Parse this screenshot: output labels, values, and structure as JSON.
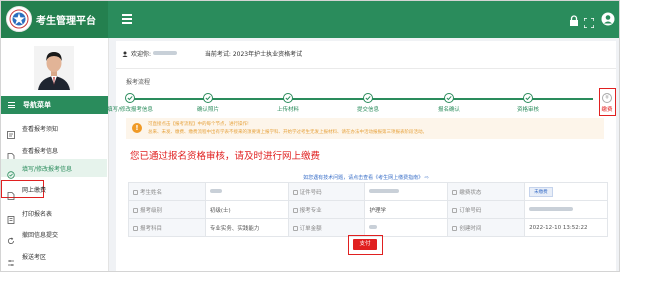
{
  "app": {
    "title": "考生管理平台"
  },
  "topbar": {
    "icons": [
      "lock-icon",
      "fullscreen-icon",
      "account-icon"
    ]
  },
  "sidebar": {
    "nav_header": "导航菜单",
    "items": [
      {
        "label": "查看报考须知",
        "icon": "notice-icon"
      },
      {
        "label": "查看报考信息",
        "icon": "document-icon"
      },
      {
        "label": "填写/修改报考信息",
        "icon": "edit-icon",
        "active": true
      },
      {
        "label": "网上缴费",
        "icon": "payment-icon",
        "highlighted": true
      },
      {
        "label": "打印报名表",
        "icon": "print-icon"
      },
      {
        "label": "撤回信息提交",
        "icon": "undo-icon"
      },
      {
        "label": "报送考区",
        "icon": "area-icon"
      }
    ]
  },
  "header": {
    "welcome_label": "欢迎你:",
    "exam_label": "当前考试:",
    "exam_name": "2023年护士执业资格考试"
  },
  "process": {
    "title": "报考流程",
    "steps": [
      {
        "label": "填写/修改报考信息",
        "done": true
      },
      {
        "label": "确认照片",
        "done": true
      },
      {
        "label": "上传材料",
        "done": true
      },
      {
        "label": "提交信息",
        "done": true
      },
      {
        "label": "报名确认",
        "done": true
      },
      {
        "label": "资格审核",
        "done": true
      },
      {
        "label": "缴费",
        "done": false
      }
    ],
    "pending_symbol": "¥"
  },
  "notice": {
    "icon": "!",
    "line1": "可直接点击【报考流程】中的每个节点，进行操作!",
    "line2": "总来、未发、缴费、缴费流程中出有学表不接来的须要请上报学科、开始学过考生无发上报材料、请在办法中活动报报第三项报表阶段活动。"
  },
  "status_message": "您已通过报名资格审核，请及时进行网上缴费",
  "tip": "如您遇有技术问题，请点击查看《考生网上缴费指南》 ⇨",
  "table": {
    "rows": [
      [
        {
          "key": "考生姓名",
          "value": "",
          "blur": 12
        },
        {
          "key": "证件号码",
          "value": "",
          "blur": 30
        },
        {
          "key": "缴费状态",
          "value": ""
        },
        {
          "tag": "未缴费"
        }
      ],
      [
        {
          "key": "报考级别",
          "value": "初级(士)"
        },
        {
          "key": "报考专业",
          "value": "护理学"
        },
        {
          "key": "订单号码",
          "value": "",
          "blur": 44
        }
      ],
      [
        {
          "key": "报考科目",
          "value": "专业实务、实践能力"
        },
        {
          "key": "订单金额",
          "value": "",
          "blur": 8
        },
        {
          "key": "创建时间",
          "value": "2022-12-10 13:52:22"
        }
      ]
    ]
  },
  "pay_button": "支付",
  "colors": {
    "primary": "#2a8c5c",
    "highlight": "#e02020",
    "notice": "#e6a23c",
    "link": "#3a6fc8"
  }
}
